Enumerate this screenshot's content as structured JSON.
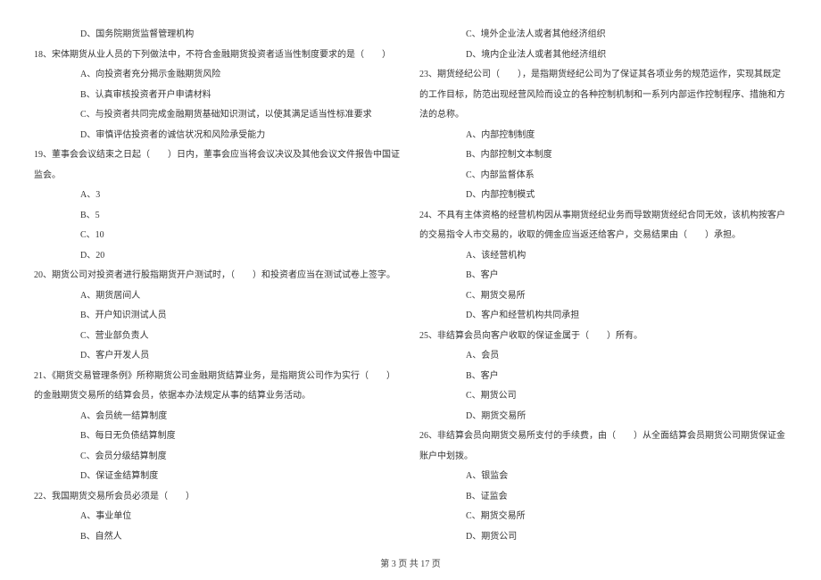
{
  "left": {
    "l0": "D、国务院期货监督管理机构",
    "q18": "18、宋体期货从业人员的下列做法中，不符合金融期货投资者适当性制度要求的是（　　）",
    "q18a": "A、向投资者充分揭示金融期货风险",
    "q18b": "B、认真审核投资者开户申请材料",
    "q18c": "C、与投资者共同完成金融期货基础知识测试，以使其满足适当性标准要求",
    "q18d": "D、审慎评估投资者的诚信状况和风险承受能力",
    "q19": "19、董事会会议结束之日起（　　）日内，董事会应当将会议决议及其他会议文件报告中国证",
    "q19_cont": "监会。",
    "q19a": "A、3",
    "q19b": "B、5",
    "q19c": "C、10",
    "q19d": "D、20",
    "q20": "20、期货公司对投资者进行股指期货开户测试时，（　　）和投资者应当在测试试卷上签字。",
    "q20a": "A、期货居间人",
    "q20b": "B、开户知识测试人员",
    "q20c": "C、营业部负责人",
    "q20d": "D、客户开发人员",
    "q21": "21、《期货交易管理条例》所称期货公司金融期货结算业务，是指期货公司作为实行（　　）",
    "q21_cont": "的金融期货交易所的结算会员，依据本办法规定从事的结算业务活动。",
    "q21a": "A、会员统一结算制度",
    "q21b": "B、每日无负债结算制度",
    "q21c": "C、会员分级结算制度",
    "q21d": "D、保证金结算制度",
    "q22": "22、我国期货交易所会员必须是（　　）",
    "q22a": "A、事业单位",
    "q22b": "B、自然人"
  },
  "right": {
    "q22c": "C、境外企业法人或者其他经济组织",
    "q22d": "D、境内企业法人或者其他经济组织",
    "q23": "23、期货经纪公司（　　），是指期货经纪公司为了保证其各项业务的规范运作，实现其既定",
    "q23_cont1": "的工作目标，防范出现经营风险而设立的各种控制机制和一系列内部运作控制程序、措施和方",
    "q23_cont2": "法的总称。",
    "q23a": "A、内部控制制度",
    "q23b": "B、内部控制文本制度",
    "q23c": "C、内部监督体系",
    "q23d": "D、内部控制模式",
    "q24": "24、不具有主体资格的经营机构因从事期货经纪业务而导致期货经纪合同无效，该机构按客户",
    "q24_cont": "的交易指令人市交易的，收取的佣金应当返还给客户，交易结果由（　　）承担。",
    "q24a": "A、该经营机构",
    "q24b": "B、客户",
    "q24c": "C、期货交易所",
    "q24d": "D、客户和经营机构共同承担",
    "q25": "25、非结算会员向客户收取的保证金属于（　　）所有。",
    "q25a": "A、会员",
    "q25b": "B、客户",
    "q25c": "C、期货公司",
    "q25d": "D、期货交易所",
    "q26": "26、非结算会员向期货交易所支付的手续费，由（　　）从全面结算会员期货公司期货保证金",
    "q26_cont": "账户中划拨。",
    "q26a": "A、银监会",
    "q26b": "B、证监会",
    "q26c": "C、期货交易所",
    "q26d": "D、期货公司"
  },
  "footer": "第 3 页 共 17 页"
}
